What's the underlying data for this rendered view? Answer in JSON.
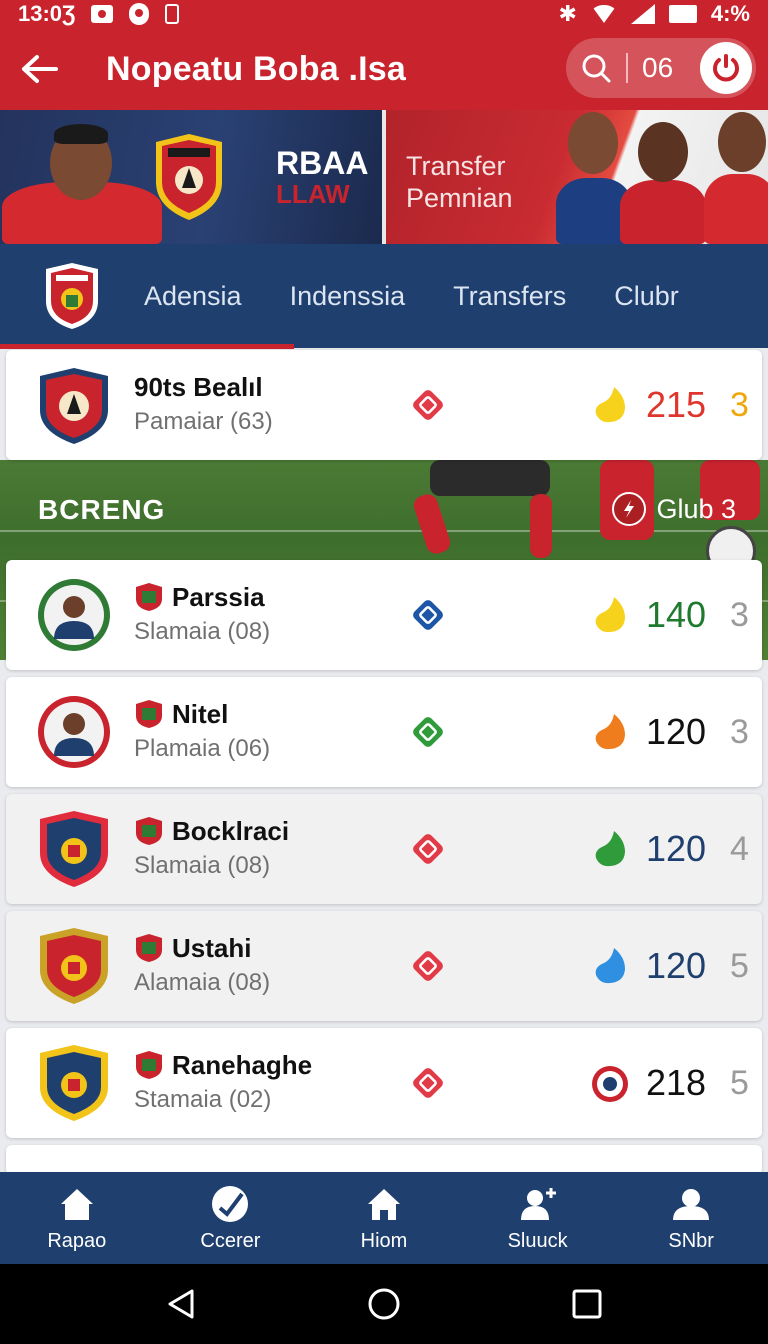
{
  "status_bar": {
    "time": "13:0Ʒ",
    "battery": "4:%"
  },
  "app_bar": {
    "back_icon": "arrow-left-icon",
    "title": "Nopeatu Boba .Isa",
    "search_icon": "search-icon",
    "count": "06",
    "power_icon": "power-icon"
  },
  "banner": {
    "brand_line1": "RBAA",
    "brand_line2": "LLAW",
    "transfer_line1": "Transfer",
    "transfer_line2": "Pemnian"
  },
  "tabs": [
    {
      "label": "Adensia"
    },
    {
      "label": "Indenssia"
    },
    {
      "label": "Transfers"
    },
    {
      "label": "Clubr"
    }
  ],
  "featured": {
    "name": "90ts Bealıl",
    "subtitle": "Pamaiar (63)",
    "score": "215",
    "rank": "3",
    "score_color": "#e0352c",
    "rank_color": "#f0a70c"
  },
  "section": {
    "label": "BCRENG",
    "right_label": "Glub 3"
  },
  "players": [
    {
      "name": "Parssia",
      "subtitle": "Slamaia (08)",
      "score": "140",
      "rank": "3",
      "score_color": "#1f7a2e",
      "diamond_color": "#1d56a6",
      "drop_color": "#f6d21d"
    },
    {
      "name": "Nitel",
      "subtitle": "Plamaia (06)",
      "score": "120",
      "rank": "3",
      "score_color": "#111111",
      "diamond_color": "#2f9b3a",
      "drop_color": "#f07d1d"
    },
    {
      "name": "Bocklraci",
      "subtitle": "Slamaia (08)",
      "score": "120",
      "rank": "4",
      "score_color": "#1f3f6e",
      "diamond_color": "#e23b48",
      "drop_color": "#2f9b3a"
    },
    {
      "name": "Ustahi",
      "subtitle": "Alamaia (08)",
      "score": "120",
      "rank": "5",
      "score_color": "#1f3f6e",
      "diamond_color": "#e23b48",
      "drop_color": "#2f8fe0"
    },
    {
      "name": "Ranehaghe",
      "subtitle": "Stamaia (02)",
      "score": "218",
      "rank": "5",
      "score_color": "#111111",
      "diamond_color": "#e23b48",
      "drop_color": "ball"
    }
  ],
  "bottom_nav": [
    {
      "label": "Rapao",
      "icon": "home-icon"
    },
    {
      "label": "Ccerer",
      "icon": "check-circle-icon"
    },
    {
      "label": "Hiom",
      "icon": "house-icon"
    },
    {
      "label": "Sluuck",
      "icon": "add-user-icon"
    },
    {
      "label": "SNbr",
      "icon": "profile-icon"
    }
  ],
  "colors": {
    "primary_red": "#c9232d",
    "navy": "#1f3f6e"
  }
}
